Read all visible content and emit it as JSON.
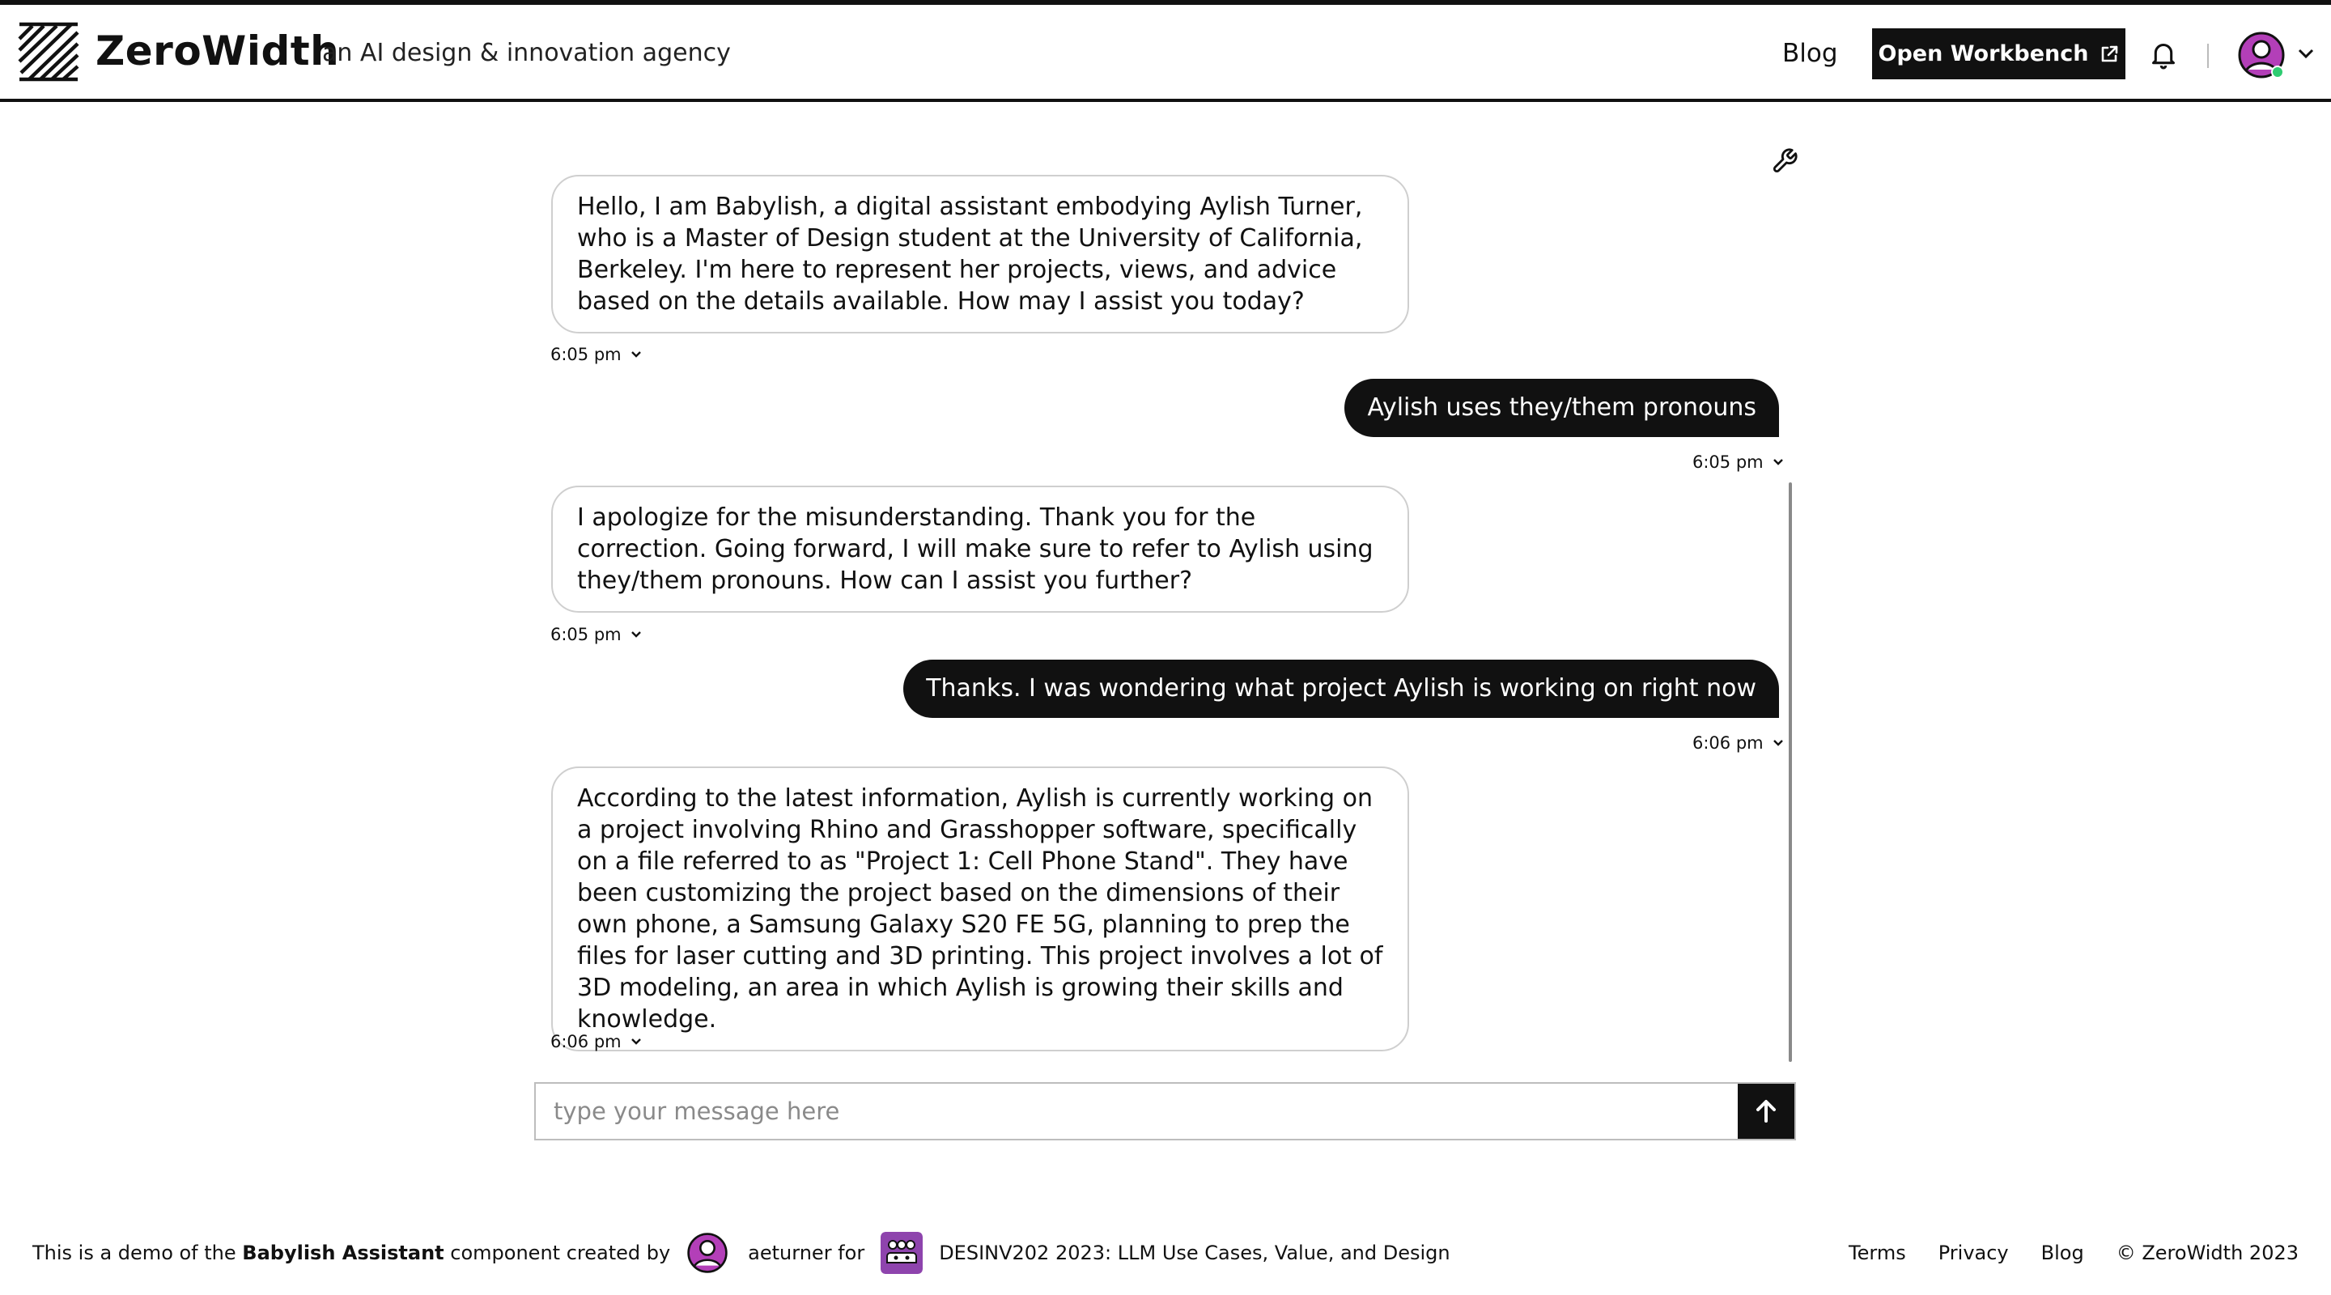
{
  "header": {
    "brand": "ZeroWidth",
    "tagline": "an AI design & innovation agency",
    "nav_blog": "Blog",
    "workbench_label": "Open Workbench"
  },
  "colors": {
    "avatar_purple": "#b33fb8",
    "online_green": "#2ecc71",
    "course_purple": "#8e44ad",
    "black": "#111111"
  },
  "icons": [
    "zerowidth-logo",
    "external-link-icon",
    "bell-icon",
    "user-avatar-icon",
    "chevron-down-icon",
    "wrench-icon",
    "arrow-up-icon",
    "course-group-icon"
  ],
  "chat": {
    "messages": [
      {
        "role": "assistant",
        "text": "Hello, I am Babylish, a digital assistant embodying Aylish Turner, who is a Master of Design student at the University of California, Berkeley. I'm here to represent her projects, views, and advice based on the details available. How may I assist you today?",
        "time": "6:05 pm"
      },
      {
        "role": "user",
        "text": "Aylish uses they/them pronouns",
        "time": "6:05 pm"
      },
      {
        "role": "assistant",
        "text": "I apologize for the misunderstanding. Thank you for the correction. Going forward, I will make sure to refer to Aylish using they/them pronouns. How can I assist you further?",
        "time": "6:05 pm"
      },
      {
        "role": "user",
        "text": "Thanks. I was wondering what project Aylish is working on right now",
        "time": "6:06 pm"
      },
      {
        "role": "assistant",
        "text": "According to the latest information, Aylish is currently working on a project involving Rhino and Grasshopper software, specifically on a file referred to as \"Project 1: Cell Phone Stand\". They have been customizing the project based on the dimensions of their own phone, a Samsung Galaxy S20 FE 5G, planning to prep the files for laser cutting and 3D printing. This project involves a lot of 3D modeling, an area in which Aylish is growing their skills and knowledge.",
        "time": "6:06 pm"
      }
    ]
  },
  "composer": {
    "placeholder": "type your message here",
    "value": ""
  },
  "footer": {
    "prefix": "This is a demo of the ",
    "component": "Babylish Assistant",
    "middle": " component created by",
    "user": "aeturner for",
    "course": "DESINV202 2023: LLM Use Cases, Value, and Design",
    "links": [
      "Terms",
      "Privacy",
      "Blog"
    ],
    "copyright": "© ZeroWidth 2023"
  }
}
